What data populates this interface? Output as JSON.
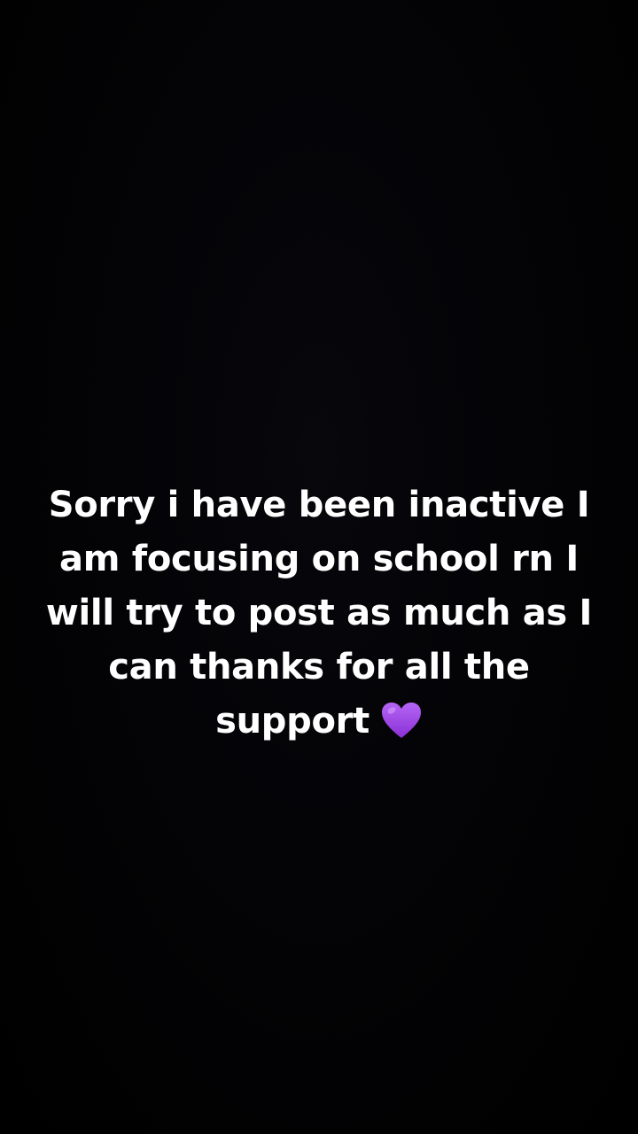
{
  "video": {
    "caption_lines": [
      "Sorry i have been inactive I",
      "am focusing on school rn I",
      "will try to post as much as I",
      "can thanks for all the",
      "support"
    ],
    "caption_emoji": "purple-heart-icon"
  },
  "colors": {
    "background": "#000000",
    "text": "#ffffff",
    "heart": "#a74fe8"
  }
}
